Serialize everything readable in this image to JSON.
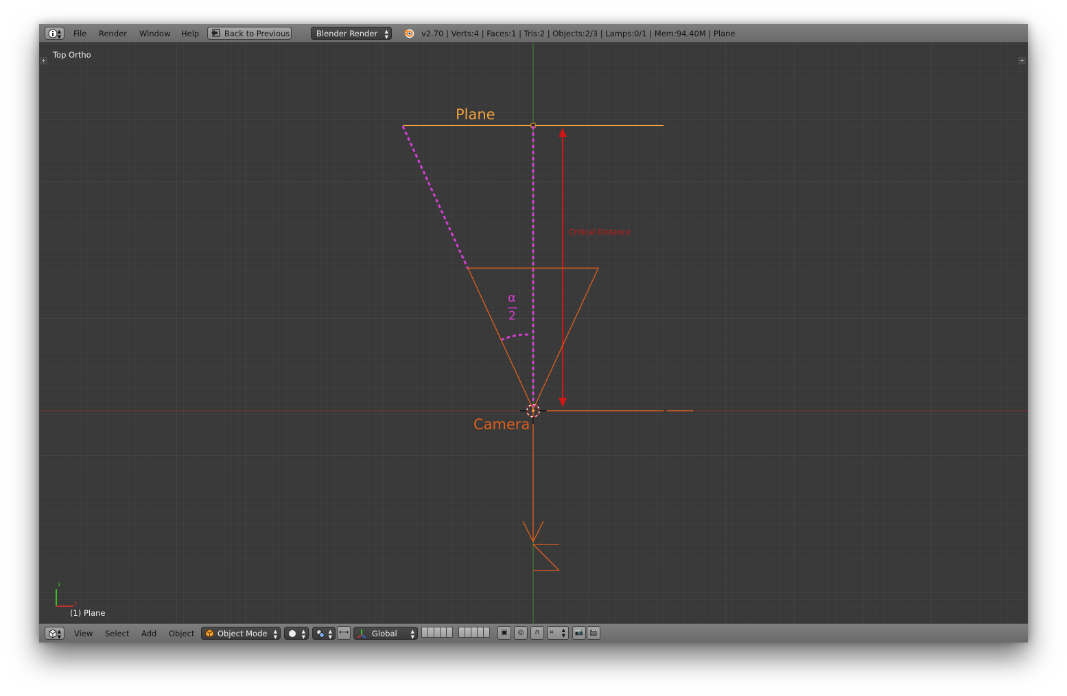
{
  "header": {
    "info_icon": "info-icon",
    "menu": [
      "File",
      "Render",
      "Window",
      "Help"
    ],
    "back_button": "Back to Previous",
    "render_engine": "Blender Render",
    "stats": "v2.70 | Verts:4 | Faces:1 | Tris:2 | Objects:2/3 | Lamps:0/1 | Mem:94.40M | Plane"
  },
  "viewport": {
    "view_name": "Top Ortho",
    "active_object": "(1) Plane",
    "axis_labels": {
      "x": "x",
      "y": "y"
    },
    "annotations": {
      "plane_label": "Plane",
      "camera_label": "Camera",
      "distance_label": "Critical Distance",
      "angle_numerator": "α",
      "angle_denominator": "2"
    },
    "colors": {
      "background": "#393939",
      "grid": "#454545",
      "x_axis": "#8a2d2d",
      "y_axis": "#3f8a2a",
      "plane": "#f4a23a",
      "camera": "#e0601b",
      "annotation_magenta": "#d63fd6",
      "distance_red": "#d01616"
    }
  },
  "footer": {
    "menu": [
      "View",
      "Select",
      "Add",
      "Object"
    ],
    "mode": "Object Mode",
    "orientation": "Global"
  }
}
